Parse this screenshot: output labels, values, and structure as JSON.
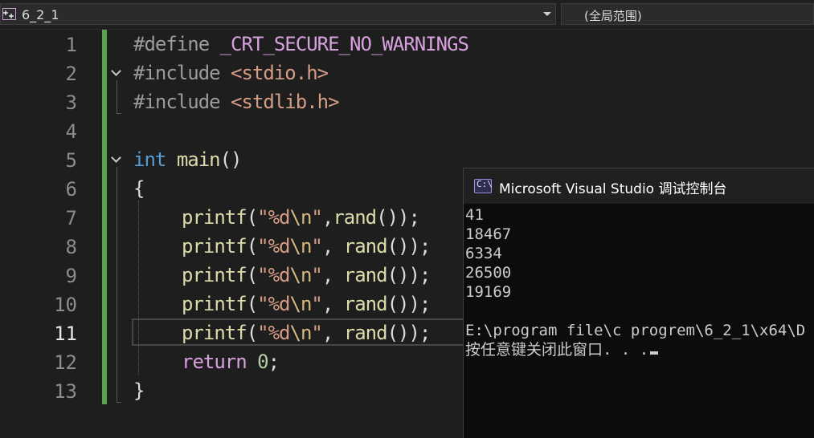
{
  "topbar": {
    "file_name": "6_2_1",
    "scope": "(全局范围)"
  },
  "editor": {
    "line_numbers": [
      "1",
      "2",
      "3",
      "4",
      "5",
      "6",
      "7",
      "8",
      "9",
      "10",
      "11",
      "12",
      "13"
    ],
    "active_line": "11",
    "tokens": {
      "l1_directive": "#define",
      "l1_macro": "_CRT_SECURE_NO_WARNINGS",
      "l2_directive": "#include",
      "l2_header": "<stdio.h>",
      "l3_directive": "#include",
      "l3_header": "<stdlib.h>",
      "l5_type": "int",
      "l5_func": "main",
      "l5_parens": "()",
      "l6_brace": "{",
      "printf": "printf",
      "open_paren": "(",
      "quote_open": "\"%d",
      "escape": "\\n",
      "quote_close": "\"",
      "comma_nospace": ",",
      "comma_space": ", ",
      "rand": "rand",
      "call_close": "());",
      "l12_return": "return",
      "l12_zero": "0",
      "semicolon": ";",
      "l13_brace": "}"
    }
  },
  "console": {
    "title": "Microsoft Visual Studio 调试控制台",
    "icon_label": "C:\\",
    "output_lines": [
      "41",
      "18467",
      "6334",
      "26500",
      "19169"
    ],
    "path_line": "E:\\program file\\c progrem\\6_2_1\\x64\\D",
    "prompt_line": "按任意键关闭此窗口. . ."
  },
  "colors": {
    "keyword": "#569cd6",
    "function": "#dcdcaa",
    "string": "#d69d85",
    "escape": "#d7ba7d",
    "number": "#b5cea8",
    "control": "#d8a0df",
    "change_bar": "#57a64a"
  },
  "icons": {
    "file": "add-source-file-icon",
    "dropdown": "chevron-down-icon",
    "console": "console-app-icon",
    "fold": "collapse-chevron-icon"
  }
}
